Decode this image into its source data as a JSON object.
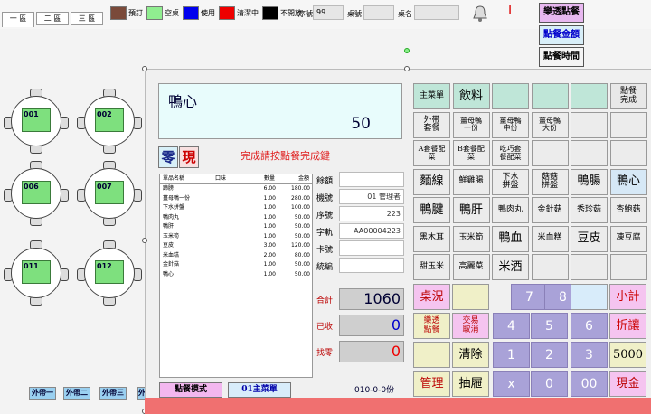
{
  "tabs": [
    "一 區",
    "二 區",
    "三 區"
  ],
  "legend": [
    {
      "label": "預訂",
      "color": "#7a4a3a"
    },
    {
      "label": "空桌",
      "color": "#90ee90"
    },
    {
      "label": "使用",
      "color": "#0000ee"
    },
    {
      "label": "清潔中",
      "color": "#ee0000"
    },
    {
      "label": "不開放",
      "color": "#000000"
    }
  ],
  "fields": {
    "serial_label": "序號",
    "serial_value": "99",
    "seat_label": "桌號",
    "seat_value": "",
    "name_label": "桌名",
    "name_value": ""
  },
  "top_buttons": {
    "letou": "樂透點餐",
    "amount": "點餐金額",
    "time": "點餐時間"
  },
  "tables": [
    "001",
    "002",
    "006",
    "007",
    "011",
    "012"
  ],
  "takeout": [
    "外帶一",
    "外帶二",
    "外帶三",
    "外"
  ],
  "display": {
    "item": "鴨心",
    "price": "50"
  },
  "zero_btn": "零",
  "now_btn": "現",
  "hint": "完成請按點餐完成鍵",
  "order": {
    "headers": [
      "單品名稱",
      "口味",
      "數量",
      "金額"
    ],
    "rows": [
      [
        "蹄膀",
        "6.00",
        "180.00"
      ],
      [
        "薑母鴨一份",
        "1.00",
        "280.00"
      ],
      [
        "下水拼盤",
        "1.00",
        "100.00"
      ],
      [
        "鴨肉丸",
        "1.00",
        "50.00"
      ],
      [
        "鴨肝",
        "1.00",
        "50.00"
      ],
      [
        "玉米筍",
        "1.00",
        "50.00"
      ],
      [
        "豆皮",
        "3.00",
        "120.00"
      ],
      [
        "米血糕",
        "2.00",
        "80.00"
      ],
      [
        "金針菇",
        "1.00",
        "50.00"
      ],
      [
        "鴨心",
        "1.00",
        "50.00"
      ]
    ]
  },
  "info": [
    {
      "label": "餘額",
      "value": ""
    },
    {
      "label": "機號",
      "value": "01 管理者"
    },
    {
      "label": "序號",
      "value": "223"
    },
    {
      "label": "字軌",
      "value": "AA00004223"
    },
    {
      "label": "卡號",
      "value": ""
    },
    {
      "label": "統編",
      "value": ""
    }
  ],
  "totals": [
    {
      "label": "合計",
      "value": "1060"
    },
    {
      "label": "已收",
      "value": "0"
    },
    {
      "label": "找零",
      "value": "0"
    }
  ],
  "mode_btn": "點餐模式",
  "menu_btn": "01主菜單",
  "qty_text": "010-0-0份",
  "menu_rows": [
    [
      {
        "t": "主菜單",
        "bg": "#bfe6d8",
        "fs": 9
      },
      {
        "t": "飲料",
        "bg": "#bfe6d8",
        "fs": 13
      },
      {
        "t": "",
        "bg": "#bfe6d8"
      },
      {
        "t": "",
        "bg": "#bfe6d8"
      },
      {
        "t": "",
        "bg": "#bfe6d8"
      },
      {
        "t": "點餐\n完成",
        "bg": "#e8e8e8",
        "fs": 9
      }
    ],
    [
      {
        "t": "外帶\n套餐",
        "bg": "#ececec",
        "fs": 9
      },
      {
        "t": "薑母鴨\n一份",
        "bg": "#ececec",
        "fs": 8
      },
      {
        "t": "薑母鴨\n中份",
        "bg": "#ececec",
        "fs": 8
      },
      {
        "t": "薑母鴨\n大份",
        "bg": "#ececec",
        "fs": 8
      },
      {
        "t": "",
        "bg": "#ececec"
      },
      {
        "t": "",
        "bg": "#ececec"
      }
    ],
    [
      {
        "t": "A套餐配\n菜",
        "bg": "#ececec",
        "fs": 8
      },
      {
        "t": "B套餐配\n菜",
        "bg": "#ececec",
        "fs": 8
      },
      {
        "t": "吃巧套\n餐配菜",
        "bg": "#ececec",
        "fs": 8
      },
      {
        "t": "",
        "bg": "#ececec"
      },
      {
        "t": "",
        "bg": "#ececec"
      },
      {
        "t": "",
        "bg": "#ececec"
      }
    ],
    [
      {
        "t": "麵線",
        "bg": "#ececec",
        "fs": 13
      },
      {
        "t": "鮮雞腸",
        "bg": "#ececec",
        "fs": 9
      },
      {
        "t": "下水\n拼盤",
        "bg": "#ececec",
        "fs": 9
      },
      {
        "t": "菇菇\n拼盤",
        "bg": "#ececec",
        "fs": 9
      },
      {
        "t": "鴨腸",
        "bg": "#ececec",
        "fs": 13
      },
      {
        "t": "鴨心",
        "bg": "#d6e8f6",
        "fs": 13
      }
    ],
    [
      {
        "t": "鴨腱",
        "bg": "#ececec",
        "fs": 13
      },
      {
        "t": "鴨肝",
        "bg": "#ececec",
        "fs": 13
      },
      {
        "t": "鴨肉丸",
        "bg": "#ececec",
        "fs": 9
      },
      {
        "t": "金針菇",
        "bg": "#ececec",
        "fs": 9
      },
      {
        "t": "秀珍菇",
        "bg": "#ececec",
        "fs": 9
      },
      {
        "t": "杏鮑菇",
        "bg": "#ececec",
        "fs": 9
      }
    ],
    [
      {
        "t": "黑木耳",
        "bg": "#ececec",
        "fs": 9
      },
      {
        "t": "玉米筍",
        "bg": "#ececec",
        "fs": 9
      },
      {
        "t": "鴨血",
        "bg": "#ececec",
        "fs": 13
      },
      {
        "t": "米血糕",
        "bg": "#ececec",
        "fs": 9
      },
      {
        "t": "豆皮",
        "bg": "#ececec",
        "fs": 13
      },
      {
        "t": "凍豆腐",
        "bg": "#ececec",
        "fs": 9
      }
    ],
    [
      {
        "t": "甜玉米",
        "bg": "#ececec",
        "fs": 9
      },
      {
        "t": "高麗菜",
        "bg": "#ececec",
        "fs": 9
      },
      {
        "t": "米酒",
        "bg": "#ececec",
        "fs": 13
      },
      {
        "t": "",
        "bg": "#ececec"
      },
      {
        "t": "",
        "bg": "#ececec"
      },
      {
        "t": "",
        "bg": "#ececec"
      }
    ]
  ],
  "func_btns": {
    "table": "桌況",
    "letou": "樂透\n點餐",
    "cancel": "交易\n取消",
    "clear": "清除",
    "manage": "管理",
    "drawer": "抽屜",
    "subtotal": "小計",
    "discount": "折讓",
    "cash5000": "5000",
    "cash": "現金"
  },
  "keypad": [
    "7",
    "8",
    "4",
    "5",
    "6",
    "1",
    "2",
    "3",
    "x",
    "0",
    "00"
  ]
}
